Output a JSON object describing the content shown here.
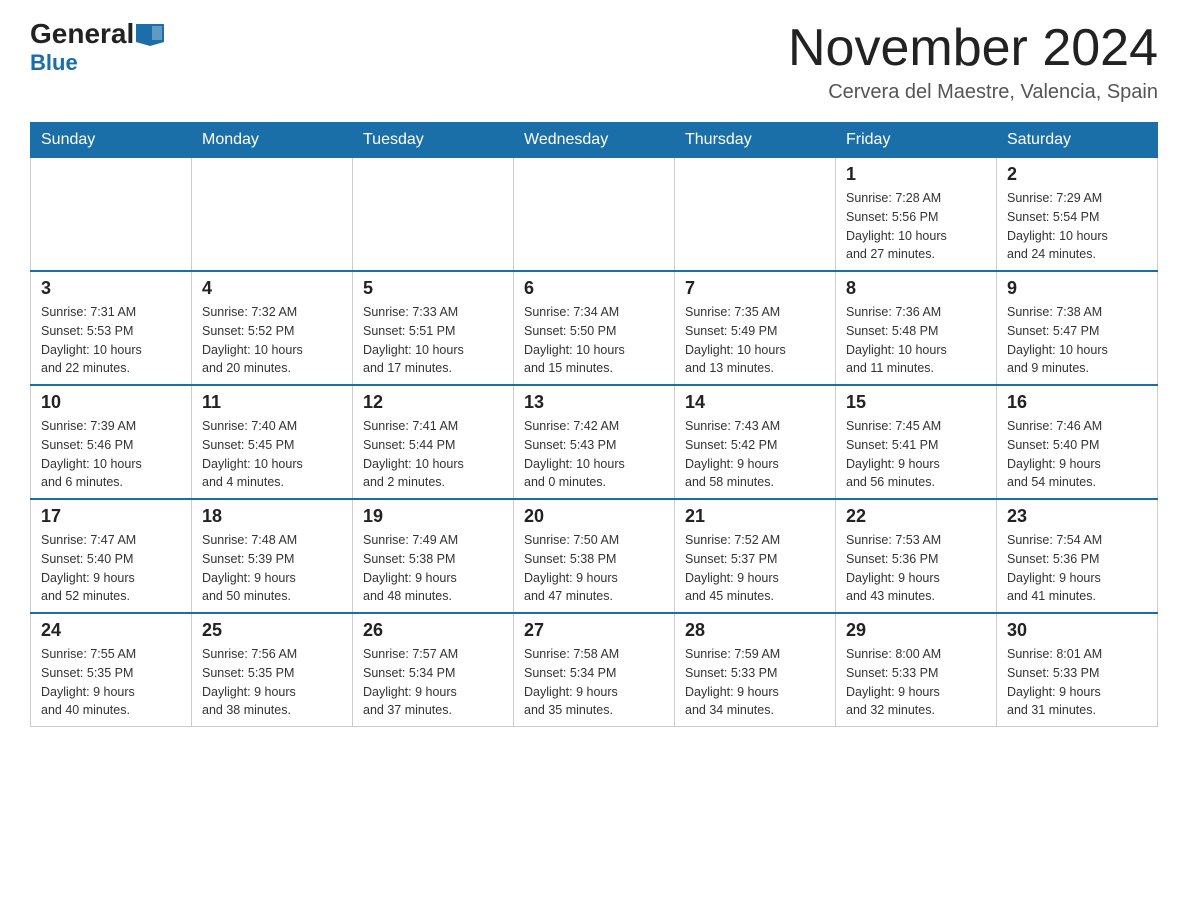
{
  "header": {
    "logo_line1": "General",
    "logo_arrow": "▶",
    "logo_line2": "Blue",
    "month_year": "November 2024",
    "location": "Cervera del Maestre, Valencia, Spain"
  },
  "weekdays": [
    "Sunday",
    "Monday",
    "Tuesday",
    "Wednesday",
    "Thursday",
    "Friday",
    "Saturday"
  ],
  "weeks": [
    [
      {
        "day": "",
        "info": ""
      },
      {
        "day": "",
        "info": ""
      },
      {
        "day": "",
        "info": ""
      },
      {
        "day": "",
        "info": ""
      },
      {
        "day": "",
        "info": ""
      },
      {
        "day": "1",
        "info": "Sunrise: 7:28 AM\nSunset: 5:56 PM\nDaylight: 10 hours\nand 27 minutes."
      },
      {
        "day": "2",
        "info": "Sunrise: 7:29 AM\nSunset: 5:54 PM\nDaylight: 10 hours\nand 24 minutes."
      }
    ],
    [
      {
        "day": "3",
        "info": "Sunrise: 7:31 AM\nSunset: 5:53 PM\nDaylight: 10 hours\nand 22 minutes."
      },
      {
        "day": "4",
        "info": "Sunrise: 7:32 AM\nSunset: 5:52 PM\nDaylight: 10 hours\nand 20 minutes."
      },
      {
        "day": "5",
        "info": "Sunrise: 7:33 AM\nSunset: 5:51 PM\nDaylight: 10 hours\nand 17 minutes."
      },
      {
        "day": "6",
        "info": "Sunrise: 7:34 AM\nSunset: 5:50 PM\nDaylight: 10 hours\nand 15 minutes."
      },
      {
        "day": "7",
        "info": "Sunrise: 7:35 AM\nSunset: 5:49 PM\nDaylight: 10 hours\nand 13 minutes."
      },
      {
        "day": "8",
        "info": "Sunrise: 7:36 AM\nSunset: 5:48 PM\nDaylight: 10 hours\nand 11 minutes."
      },
      {
        "day": "9",
        "info": "Sunrise: 7:38 AM\nSunset: 5:47 PM\nDaylight: 10 hours\nand 9 minutes."
      }
    ],
    [
      {
        "day": "10",
        "info": "Sunrise: 7:39 AM\nSunset: 5:46 PM\nDaylight: 10 hours\nand 6 minutes."
      },
      {
        "day": "11",
        "info": "Sunrise: 7:40 AM\nSunset: 5:45 PM\nDaylight: 10 hours\nand 4 minutes."
      },
      {
        "day": "12",
        "info": "Sunrise: 7:41 AM\nSunset: 5:44 PM\nDaylight: 10 hours\nand 2 minutes."
      },
      {
        "day": "13",
        "info": "Sunrise: 7:42 AM\nSunset: 5:43 PM\nDaylight: 10 hours\nand 0 minutes."
      },
      {
        "day": "14",
        "info": "Sunrise: 7:43 AM\nSunset: 5:42 PM\nDaylight: 9 hours\nand 58 minutes."
      },
      {
        "day": "15",
        "info": "Sunrise: 7:45 AM\nSunset: 5:41 PM\nDaylight: 9 hours\nand 56 minutes."
      },
      {
        "day": "16",
        "info": "Sunrise: 7:46 AM\nSunset: 5:40 PM\nDaylight: 9 hours\nand 54 minutes."
      }
    ],
    [
      {
        "day": "17",
        "info": "Sunrise: 7:47 AM\nSunset: 5:40 PM\nDaylight: 9 hours\nand 52 minutes."
      },
      {
        "day": "18",
        "info": "Sunrise: 7:48 AM\nSunset: 5:39 PM\nDaylight: 9 hours\nand 50 minutes."
      },
      {
        "day": "19",
        "info": "Sunrise: 7:49 AM\nSunset: 5:38 PM\nDaylight: 9 hours\nand 48 minutes."
      },
      {
        "day": "20",
        "info": "Sunrise: 7:50 AM\nSunset: 5:38 PM\nDaylight: 9 hours\nand 47 minutes."
      },
      {
        "day": "21",
        "info": "Sunrise: 7:52 AM\nSunset: 5:37 PM\nDaylight: 9 hours\nand 45 minutes."
      },
      {
        "day": "22",
        "info": "Sunrise: 7:53 AM\nSunset: 5:36 PM\nDaylight: 9 hours\nand 43 minutes."
      },
      {
        "day": "23",
        "info": "Sunrise: 7:54 AM\nSunset: 5:36 PM\nDaylight: 9 hours\nand 41 minutes."
      }
    ],
    [
      {
        "day": "24",
        "info": "Sunrise: 7:55 AM\nSunset: 5:35 PM\nDaylight: 9 hours\nand 40 minutes."
      },
      {
        "day": "25",
        "info": "Sunrise: 7:56 AM\nSunset: 5:35 PM\nDaylight: 9 hours\nand 38 minutes."
      },
      {
        "day": "26",
        "info": "Sunrise: 7:57 AM\nSunset: 5:34 PM\nDaylight: 9 hours\nand 37 minutes."
      },
      {
        "day": "27",
        "info": "Sunrise: 7:58 AM\nSunset: 5:34 PM\nDaylight: 9 hours\nand 35 minutes."
      },
      {
        "day": "28",
        "info": "Sunrise: 7:59 AM\nSunset: 5:33 PM\nDaylight: 9 hours\nand 34 minutes."
      },
      {
        "day": "29",
        "info": "Sunrise: 8:00 AM\nSunset: 5:33 PM\nDaylight: 9 hours\nand 32 minutes."
      },
      {
        "day": "30",
        "info": "Sunrise: 8:01 AM\nSunset: 5:33 PM\nDaylight: 9 hours\nand 31 minutes."
      }
    ]
  ]
}
